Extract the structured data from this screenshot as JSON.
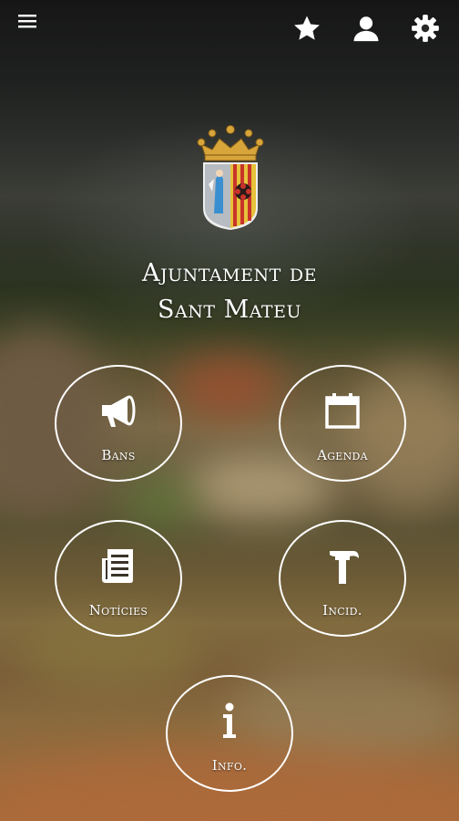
{
  "header": {
    "menu_icon": "hamburger-menu-icon",
    "favorites_icon": "star-icon",
    "profile_icon": "user-icon",
    "settings_icon": "gear-icon"
  },
  "hero": {
    "crest_icon": "town-coat-of-arms",
    "title_line1": "Ajuntament de",
    "title_line2": "Sant Mateu"
  },
  "tiles": [
    {
      "label": "Bans",
      "icon": "megaphone-icon"
    },
    {
      "label": "Agenda",
      "icon": "calendar-icon"
    },
    {
      "label": "Notícies",
      "icon": "newspaper-icon"
    },
    {
      "label": "Incid.",
      "icon": "hammer-icon"
    },
    {
      "label": "Info.",
      "icon": "info-icon"
    }
  ],
  "colors": {
    "text": "#ffffff",
    "crest_gold": "#d8a53a",
    "crest_red": "#c8342a",
    "crest_blue": "#3a8fd0"
  }
}
